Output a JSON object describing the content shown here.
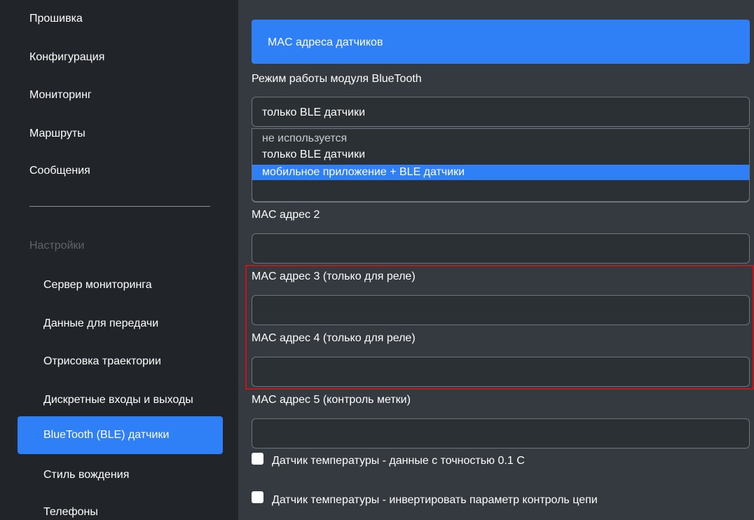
{
  "sidebar": {
    "top_items": [
      {
        "label": "Прошивка"
      },
      {
        "label": "Конфигурация"
      },
      {
        "label": "Мониторинг"
      },
      {
        "label": "Маршруты"
      },
      {
        "label": "Сообщения"
      }
    ],
    "section_label": "Настройки",
    "sub_items": [
      {
        "label": "Сервер мониторинга"
      },
      {
        "label": "Данные для передачи"
      },
      {
        "label": "Отрисовка траектории"
      },
      {
        "label": "Дискретные входы и выходы"
      },
      {
        "label": "BlueTooth (BLE) датчики",
        "active": true
      },
      {
        "label": "Стиль вождения"
      },
      {
        "label": "Телефоны"
      }
    ]
  },
  "main": {
    "header_button": "MAC адреса датчиков",
    "bt_mode": {
      "label": "Режим работы модуля BlueTooth",
      "value": "только BLE датчики",
      "options": [
        {
          "label": "не используется"
        },
        {
          "label": "только BLE датчики"
        },
        {
          "label": "мобильное приложение + BLE датчики",
          "highlighted": true
        }
      ]
    },
    "mac_fields": [
      {
        "label": "MAC адрес 2",
        "value": ""
      },
      {
        "label": "MAC адрес 3 (только для реле)",
        "value": ""
      },
      {
        "label": "MAC адрес 4 (только для реле)",
        "value": ""
      },
      {
        "label": "MAC адрес 5 (контроль метки)",
        "value": ""
      }
    ],
    "checkboxes": [
      {
        "label": "Датчик температуры - данные с точностью 0.1 С",
        "checked": false
      },
      {
        "label": "Датчик температуры - инвертировать параметр контроль цепи",
        "checked": false
      }
    ],
    "colors": {
      "accent": "#2f80f6",
      "sidebar_bg": "#212529",
      "main_bg": "#343a40",
      "highlight_border": "#c0141e"
    }
  }
}
